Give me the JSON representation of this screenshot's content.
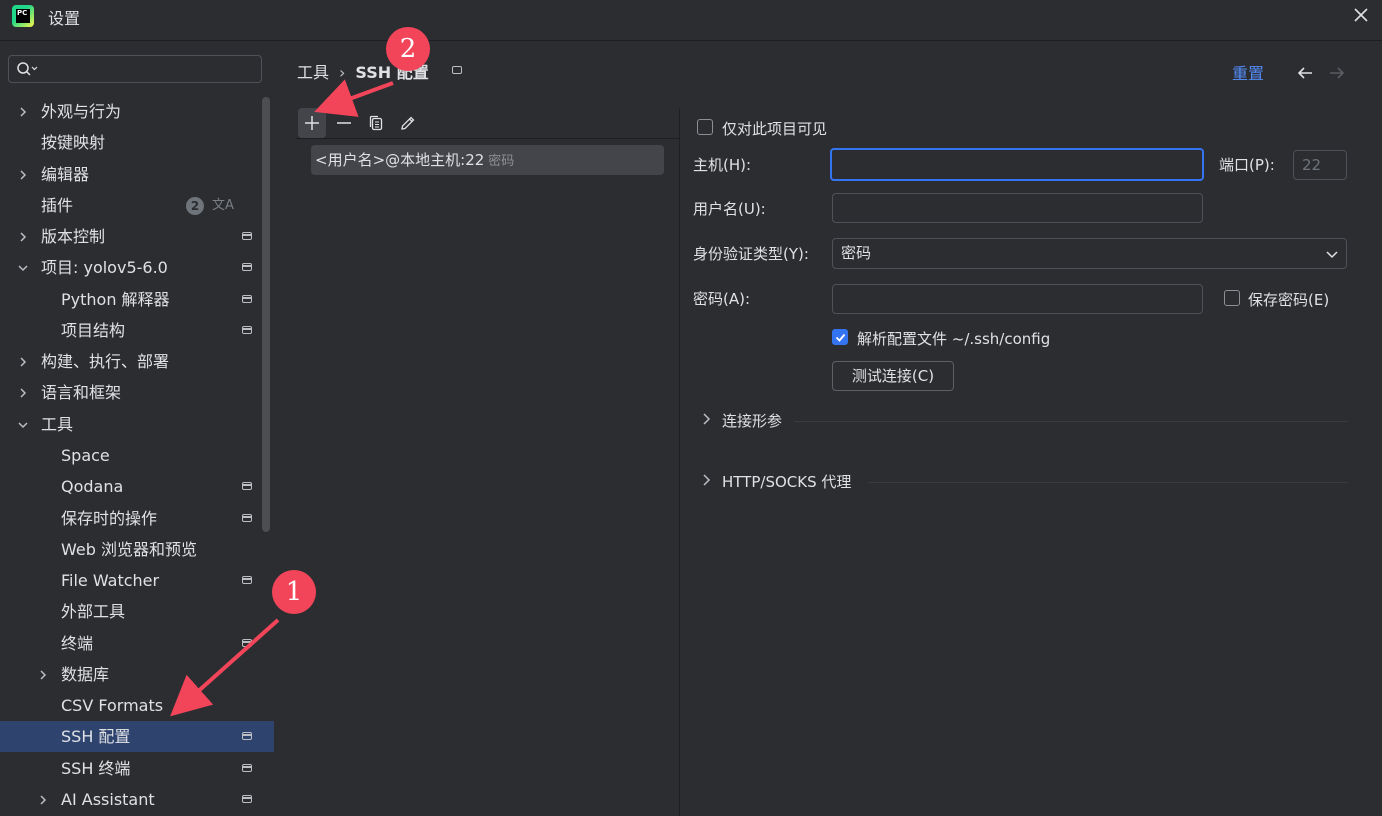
{
  "window": {
    "title": "设置",
    "close_icon": "close-icon",
    "app_icon": "pycharm-logo-icon",
    "app_icon_text": "PC"
  },
  "sidebar": {
    "search": {
      "placeholder": "",
      "icon": "search-icon"
    },
    "items": [
      {
        "label": "外观与行为",
        "expandable": true,
        "expanded": false,
        "level": 0
      },
      {
        "label": "按键映射",
        "expandable": false,
        "level": 0
      },
      {
        "label": "编辑器",
        "expandable": true,
        "expanded": false,
        "level": 0
      },
      {
        "label": "插件",
        "expandable": false,
        "level": 0,
        "badge": "2",
        "badge_icon": "translate-icon"
      },
      {
        "label": "版本控制",
        "expandable": true,
        "expanded": false,
        "level": 0,
        "project_icon": true
      },
      {
        "label": "项目: yolov5-6.0",
        "expandable": true,
        "expanded": true,
        "level": 0,
        "project_icon": true
      },
      {
        "label": "Python 解释器",
        "level": 1,
        "project_icon": true
      },
      {
        "label": "项目结构",
        "level": 1,
        "project_icon": true
      },
      {
        "label": "构建、执行、部署",
        "expandable": true,
        "expanded": false,
        "level": 0
      },
      {
        "label": "语言和框架",
        "expandable": true,
        "expanded": false,
        "level": 0
      },
      {
        "label": "工具",
        "expandable": true,
        "expanded": true,
        "level": 0
      },
      {
        "label": "Space",
        "level": 1
      },
      {
        "label": "Qodana",
        "level": 1,
        "project_icon": true
      },
      {
        "label": "保存时的操作",
        "level": 1,
        "project_icon": true
      },
      {
        "label": "Web 浏览器和预览",
        "level": 1
      },
      {
        "label": "File Watcher",
        "level": 1,
        "project_icon": true
      },
      {
        "label": "外部工具",
        "level": 1
      },
      {
        "label": "终端",
        "level": 1,
        "project_icon": true
      },
      {
        "label": "数据库",
        "level": 1,
        "expandable": true,
        "expanded": false
      },
      {
        "label": "CSV Formats",
        "level": 1
      },
      {
        "label": "SSH 配置",
        "level": 1,
        "project_icon": true,
        "selected": true
      },
      {
        "label": "SSH 终端",
        "level": 1,
        "project_icon": true
      },
      {
        "label": "AI Assistant",
        "level": 1,
        "expandable": true,
        "expanded": false,
        "project_icon": true
      }
    ]
  },
  "breadcrumb": {
    "parent": "工具",
    "separator": "›",
    "current": "SSH 配置"
  },
  "header": {
    "reset_label": "重置",
    "back_icon": "arrow-left-icon",
    "forward_icon": "arrow-right-icon"
  },
  "list_toolbar": {
    "add_icon": "plus-icon",
    "remove_icon": "minus-icon",
    "copy_icon": "copy-icon",
    "edit_icon": "pencil-icon"
  },
  "connections": [
    {
      "label": "<用户名>@本地主机:22",
      "auth": "密码"
    }
  ],
  "form": {
    "project_only_label": "仅对此项目可见",
    "project_only_checked": false,
    "host_label": "主机(H):",
    "host_value": "",
    "port_label": "端口(P):",
    "port_value": "22",
    "username_label": "用户名(U):",
    "username_value": "",
    "auth_label": "身份验证类型(Y):",
    "auth_value": "密码",
    "password_label": "密码(A):",
    "password_value": "",
    "save_password_label": "保存密码(E)",
    "save_password_checked": false,
    "parse_config_label": "解析配置文件 ~/.ssh/config",
    "parse_config_checked": true,
    "test_button_label": "测试连接(C)",
    "section_connection_params": "连接形参",
    "section_proxy": "HTTP/SOCKS 代理"
  },
  "annotations": {
    "marker_1": "1",
    "marker_2": "2",
    "color": "#f3455a"
  },
  "colors": {
    "accent": "#3574f0",
    "link": "#548af7",
    "selection": "#2e436e",
    "background": "#2b2d30"
  }
}
